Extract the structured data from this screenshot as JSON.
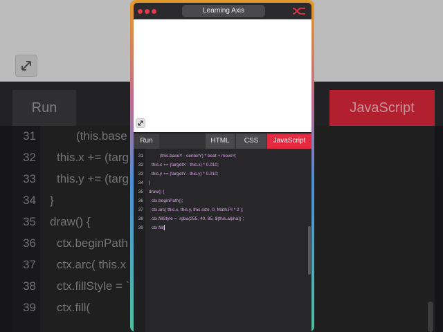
{
  "window": {
    "title": "Learning Axis"
  },
  "tabs": {
    "run": "Run",
    "html": "HTML",
    "css": "CSS",
    "javascript": "JavaScript"
  },
  "colors": {
    "accent": "#e5293e",
    "code_text": "#d9a7e8",
    "editor_bg": "#272729"
  },
  "icons": {
    "logo": "learning-axis-logo",
    "expand": "expand-arrows-icon"
  },
  "editor": {
    "lines": [
      {
        "num": "31",
        "text": "(this.baseY - centerY) * beat + moveY;"
      },
      {
        "num": "32",
        "text": "this.x += (targetX - this.x) * 0.010;"
      },
      {
        "num": "33",
        "text": "this.y += (targetY - this.y) * 0.010;"
      },
      {
        "num": "34",
        "text": "}"
      },
      {
        "num": "35",
        "text": "draw() {"
      },
      {
        "num": "36",
        "text": "ctx.beginPath();"
      },
      {
        "num": "37",
        "text": "ctx.arc( this.x, this.y, this.size, 0, Math.PI * 2 );"
      },
      {
        "num": "38",
        "text": "ctx.fillStyle = `rgba(255, 40, 85, ${this.alpha})`;"
      },
      {
        "num": "39",
        "text": "ctx.fill("
      }
    ]
  },
  "background": {
    "run": "Run",
    "javascript": "JavaScript",
    "lines": [
      {
        "num": "31",
        "text": "(this.base"
      },
      {
        "num": "32",
        "text": "this.x += (targ"
      },
      {
        "num": "33",
        "text": "this.y += (targ"
      },
      {
        "num": "34",
        "text": "}"
      },
      {
        "num": "35",
        "text": "draw() {"
      },
      {
        "num": "36",
        "text": "ctx.beginPath"
      },
      {
        "num": "37",
        "text": "ctx.arc( this.x"
      },
      {
        "num": "38",
        "text": "ctx.fillStyle = `"
      },
      {
        "num": "39",
        "text": "ctx.fill("
      }
    ]
  }
}
